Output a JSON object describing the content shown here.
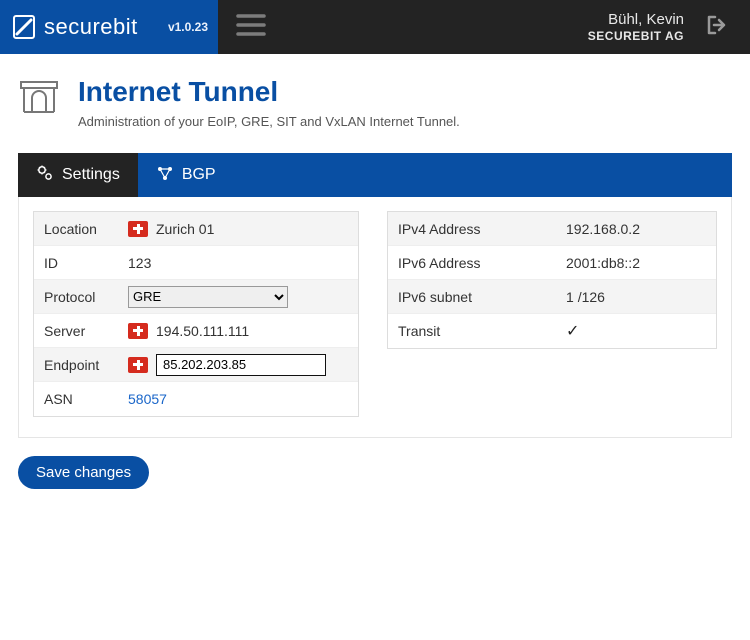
{
  "header": {
    "brand": "securebit",
    "version": "v1.0.23",
    "user_name": "Bühl, Kevin",
    "user_org": "SECUREBIT AG"
  },
  "page": {
    "title": "Internet Tunnel",
    "subtitle": "Administration of your EoIP, GRE, SIT and VxLAN Internet Tunnel."
  },
  "tabs": {
    "settings": "Settings",
    "bgp": "BGP"
  },
  "left": {
    "location_k": "Location",
    "location_v": "Zurich 01",
    "id_k": "ID",
    "id_v": "123",
    "protocol_k": "Protocol",
    "protocol_v": "GRE",
    "server_k": "Server",
    "server_v": "194.50.111.111",
    "endpoint_k": "Endpoint",
    "endpoint_v": "85.202.203.85",
    "asn_k": "ASN",
    "asn_v": "58057"
  },
  "right": {
    "ipv4_k": "IPv4 Address",
    "ipv4_v": "192.168.0.2",
    "ipv6_k": "IPv6 Address",
    "ipv6_v": "2001:db8::2",
    "ipv6s_k": "IPv6 subnet",
    "ipv6s_v": "1 /126",
    "transit_k": "Transit"
  },
  "buttons": {
    "save": "Save changes"
  }
}
